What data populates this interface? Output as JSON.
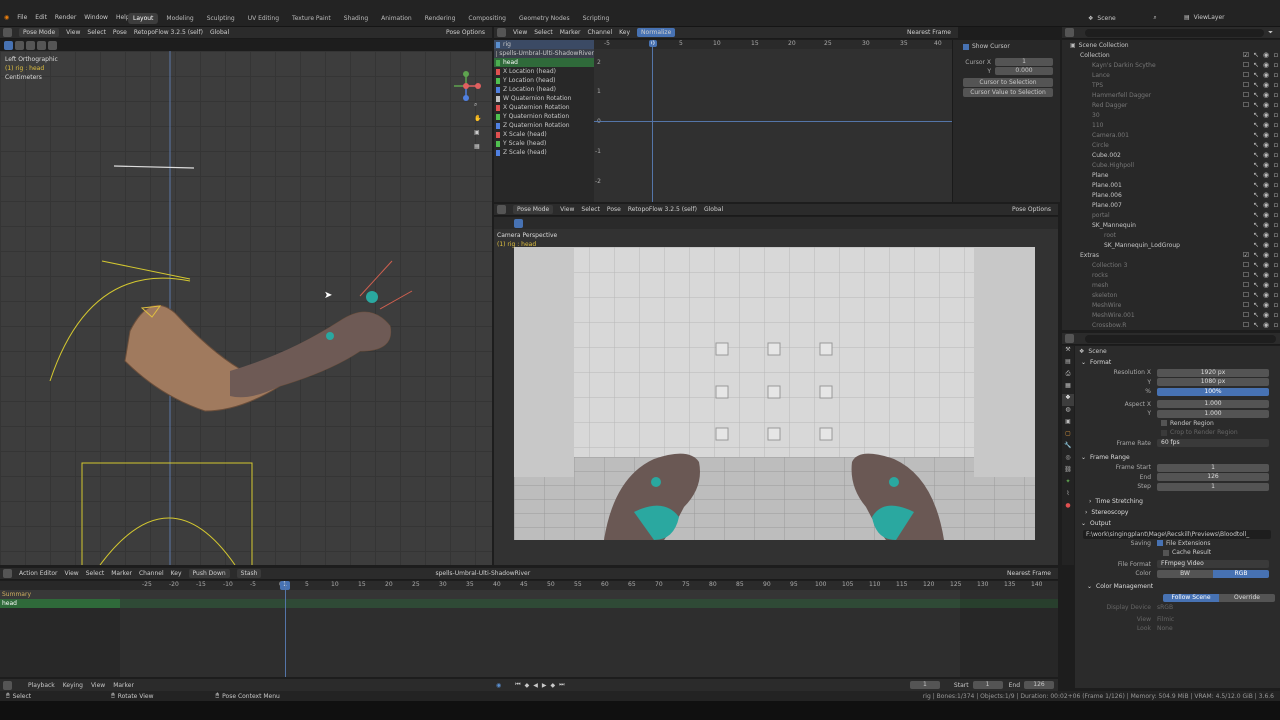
{
  "topbar": {
    "menus": [
      "File",
      "Edit",
      "Render",
      "Window",
      "Help"
    ],
    "workspaces": [
      "Layout",
      "Modeling",
      "Sculpting",
      "UV Editing",
      "Texture Paint",
      "Shading",
      "Animation",
      "Rendering",
      "Compositing",
      "Geometry Nodes",
      "Scripting"
    ],
    "active_workspace": "Layout",
    "scene": "Scene",
    "view_layer": "ViewLayer"
  },
  "viewport_left": {
    "mode": "Pose Mode",
    "menus": [
      "View",
      "Select",
      "Pose"
    ],
    "addon": "RetopoFlow 3.2.5 (self)",
    "orientation": "Global",
    "options": "Pose Options",
    "view_name": "Left Orthographic",
    "context": "(1) rig : head",
    "units": "Centimeters"
  },
  "graph_editor": {
    "menus": [
      "View",
      "Select",
      "Marker",
      "Channel",
      "Key"
    ],
    "normalize": "Normalize",
    "interp": "Nearest Frame",
    "frame_ticks": [
      "-5",
      "0",
      "5",
      "10",
      "15",
      "20",
      "25",
      "30",
      "35",
      "40"
    ],
    "value_ticks": [
      "2",
      "1",
      "0",
      "-1",
      "-2"
    ],
    "channels": [
      {
        "name": "rig",
        "color": "#5a8fd0"
      },
      {
        "name": "spells-Umbral-Ulti-ShadowRiver",
        "color": "#7a7a7a"
      },
      {
        "name": "head",
        "color": "#4caf50"
      },
      {
        "name": "X Location (head)",
        "color": "#e05050"
      },
      {
        "name": "Y Location (head)",
        "color": "#50c050"
      },
      {
        "name": "Z Location (head)",
        "color": "#5080e0"
      },
      {
        "name": "W Quaternion Rotation",
        "color": "#c0c0c0"
      },
      {
        "name": "X Quaternion Rotation",
        "color": "#e05050"
      },
      {
        "name": "Y Quaternion Rotation",
        "color": "#50c050"
      },
      {
        "name": "Z Quaternion Rotation",
        "color": "#5080e0"
      },
      {
        "name": "X Scale (head)",
        "color": "#e05050"
      },
      {
        "name": "Y Scale (head)",
        "color": "#50c050"
      },
      {
        "name": "Z Scale (head)",
        "color": "#5080e0"
      }
    ],
    "cursor_panel": {
      "show_cursor": "Show Cursor",
      "cursor_x_label": "Cursor X",
      "cursor_x": "1",
      "y_label": "Y",
      "y_val": "0.000",
      "btn1": "Cursor to Selection",
      "btn2": "Cursor Value to Selection"
    }
  },
  "viewport_right": {
    "mode": "Pose Mode",
    "menus": [
      "View",
      "Select",
      "Pose"
    ],
    "addon": "RetopoFlow 3.2.5 (self)",
    "orientation": "Global",
    "options": "Pose Options",
    "view_name": "Camera Perspective",
    "context": "(1) rig : head"
  },
  "outliner": {
    "root": "Scene Collection",
    "items": [
      {
        "name": "Collection",
        "active": true
      },
      {
        "name": "Kayn's Darkin Scythe",
        "active": false
      },
      {
        "name": "Lance",
        "active": false
      },
      {
        "name": "TPS",
        "active": false
      },
      {
        "name": "Hammerfell Dagger",
        "active": false
      },
      {
        "name": "Red Dagger",
        "active": false
      },
      {
        "name": "30",
        "active": false
      },
      {
        "name": "110",
        "active": false
      },
      {
        "name": "Camera.001",
        "active": false
      },
      {
        "name": "Circle",
        "active": false
      },
      {
        "name": "Cube.002",
        "active": true
      },
      {
        "name": "Cube.Highpoll",
        "active": false
      },
      {
        "name": "Plane",
        "active": true
      },
      {
        "name": "Plane.001",
        "active": true
      },
      {
        "name": "Plane.006",
        "active": true
      },
      {
        "name": "Plane.007",
        "active": true
      },
      {
        "name": "portal",
        "active": false
      },
      {
        "name": "SK_Mannequin",
        "active": true
      },
      {
        "name": "root",
        "active": false
      },
      {
        "name": "SK_Mannequin_LodGroup",
        "active": true
      },
      {
        "name": "Extras",
        "active": true
      },
      {
        "name": "Collection 3",
        "active": false
      },
      {
        "name": "rocks",
        "active": false
      },
      {
        "name": "mesh",
        "active": false
      },
      {
        "name": "skeleton",
        "active": false
      },
      {
        "name": "MeshWire",
        "active": false
      },
      {
        "name": "MeshWire.001",
        "active": false
      },
      {
        "name": "Crossbow.R",
        "active": false
      }
    ]
  },
  "properties": {
    "context": "Scene",
    "format_title": "Format",
    "res_x_label": "Resolution X",
    "res_x": "1920 px",
    "res_y_label": "Y",
    "res_y": "1080 px",
    "res_pct_label": "%",
    "res_pct": "100%",
    "aspect_x_label": "Aspect X",
    "aspect_x": "1.000",
    "aspect_y_label": "Y",
    "aspect_y": "1.000",
    "render_region": "Render Region",
    "crop_region": "Crop to Render Region",
    "frame_rate_label": "Frame Rate",
    "frame_rate": "60 fps",
    "frame_range_title": "Frame Range",
    "frame_start_label": "Frame Start",
    "frame_start": "1",
    "frame_end_label": "End",
    "frame_end": "126",
    "frame_step_label": "Step",
    "frame_step": "1",
    "time_stretching": "Time Stretching",
    "stereoscopy": "Stereoscopy",
    "output_title": "Output",
    "output_path": "F:\\work\\singingplant\\Mage\\Recskill\\Previews\\Bloodtoll_",
    "saving_label": "Saving",
    "file_ext": "File Extensions",
    "cache_result": "Cache Result",
    "file_format_label": "File Format",
    "file_format": "FFmpeg Video",
    "color_label": "Color",
    "color_bw": "BW",
    "color_rgb": "RGB",
    "color_mgmt": "Color Management",
    "follow_scene": "Follow Scene",
    "override": "Override",
    "display_device_label": "Display Device",
    "display_device": "sRGB",
    "view_label": "View",
    "view_val": "Filmic",
    "look_label": "Look",
    "look_val": "None"
  },
  "action_editor": {
    "editor": "Action Editor",
    "menus": [
      "View",
      "Select",
      "Marker",
      "Channel",
      "Key"
    ],
    "push_down": "Push Down",
    "stash": "Stash",
    "action_name": "spells-Umbral-Ulti-ShadowRiver",
    "interp": "Nearest Frame",
    "ticks": [
      "-25",
      "-20",
      "-15",
      "-10",
      "-5",
      "0",
      "5",
      "10",
      "15",
      "20",
      "25",
      "30",
      "35",
      "40",
      "45",
      "50",
      "55",
      "60",
      "65",
      "70",
      "75",
      "80",
      "85",
      "90",
      "95",
      "100",
      "105",
      "110",
      "115",
      "120",
      "125",
      "130",
      "135",
      "140"
    ],
    "current_frame": "1",
    "summary": "Summary",
    "head": "head"
  },
  "playback": {
    "menus": [
      "Playback",
      "Keying",
      "View",
      "Marker"
    ],
    "current": "1",
    "start_label": "Start",
    "start": "1",
    "end_label": "End",
    "end": "126"
  },
  "statusbar": {
    "select": "Select",
    "rotate": "Rotate View",
    "context_menu": "Pose Context Menu",
    "stats": "rig | Bones:1/374 | Objects:1/9 | Duration: 00:02+06 (Frame 1/126) | Memory: 504.9 MiB | VRAM: 4.5/12.0 GiB | 3.6.6"
  }
}
